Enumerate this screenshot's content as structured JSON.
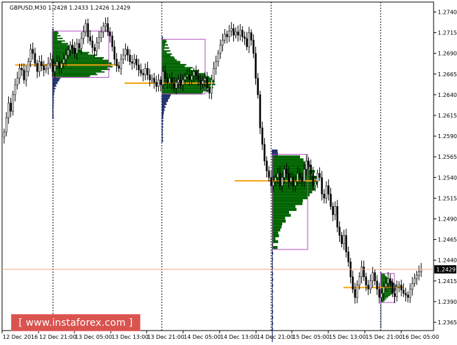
{
  "chart_data": {
    "type": "candlestick",
    "title": "GBPUSD,M30  1.2428 1.2433 1.2426 1.2429",
    "symbol": "GBPUSD",
    "timeframe": "M30",
    "ohlc_last": {
      "open": 1.2428,
      "high": 1.2433,
      "low": 1.2426,
      "close": 1.2429
    },
    "ylim": [
      1.2355,
      1.2752
    ],
    "y_ticks": [
      "1.2740",
      "1.2715",
      "1.2690",
      "1.2665",
      "1.2640",
      "1.2615",
      "1.2590",
      "1.2565",
      "1.2540",
      "1.2515",
      "1.2490",
      "1.2465",
      "1.2440",
      "1.2415",
      "1.2390",
      "1.2365"
    ],
    "x_ticks": [
      "12 Dec 2016",
      "12 Dec 21:00",
      "13 Dec 05:00",
      "13 Dec 13:00",
      "13 Dec 21:00",
      "14 Dec 05:00",
      "14 Dec 13:00",
      "14 Dec 21:00",
      "15 Dec 05:00",
      "15 Dec 13:00",
      "15 Dec 21:00",
      "16 Dec 05:00"
    ],
    "current_price": "1.2429",
    "current_price_line_color": "#f4a582",
    "candle_color": "#000000",
    "session_separators": [
      "12 Dec 21:00",
      "13 Dec 21:00",
      "14 Dec 21:00",
      "15 Dec 21:00"
    ],
    "closes": [
      1.2595,
      1.2612,
      1.263,
      1.262,
      1.264,
      1.2652,
      1.266,
      1.2672,
      1.267,
      1.2658,
      1.2668,
      1.268,
      1.2695,
      1.269,
      1.2678,
      1.2668,
      1.268,
      1.2675,
      1.267,
      1.2672,
      1.2678,
      1.2683,
      1.2668,
      1.2675,
      1.268,
      1.2672,
      1.2678,
      1.2683,
      1.2688,
      1.2694,
      1.27,
      1.2696,
      1.269,
      1.2702,
      1.2696,
      1.2708,
      1.2716,
      1.2726,
      1.271,
      1.2705,
      1.2697,
      1.2693,
      1.2703,
      1.2709,
      1.2716,
      1.2723,
      1.2726,
      1.2716,
      1.2711,
      1.2698,
      1.2683,
      1.2675,
      1.2672,
      1.2683,
      1.2688,
      1.2695,
      1.2688,
      1.268,
      1.2678,
      1.2683,
      1.2676,
      1.267,
      1.2666,
      1.2664,
      1.2672,
      1.2664,
      1.2658,
      1.266,
      1.2655,
      1.265,
      1.2658,
      1.2652,
      1.2668,
      1.266,
      1.2654,
      1.266,
      1.2654,
      1.2648,
      1.2655,
      1.2658,
      1.2652,
      1.2658,
      1.2662,
      1.2664,
      1.2658,
      1.2663,
      1.2668,
      1.2663,
      1.2658,
      1.2653,
      1.2657,
      1.266,
      1.2648,
      1.2642,
      1.2658,
      1.2672,
      1.268,
      1.269,
      1.27,
      1.2706,
      1.2713,
      1.271,
      1.2717,
      1.272,
      1.2712,
      1.2716,
      1.2712,
      1.2718,
      1.271,
      1.2708,
      1.2698,
      1.2715,
      1.2706,
      1.269,
      1.266,
      1.264,
      1.26,
      1.258,
      1.256,
      1.2548,
      1.254,
      1.253,
      1.2535,
      1.254,
      1.2545,
      1.253,
      1.254,
      1.255,
      1.2545,
      1.2535,
      1.254,
      1.253,
      1.2535,
      1.2545,
      1.254,
      1.2535,
      1.255,
      1.256,
      1.2555,
      1.2545,
      1.253,
      1.2535,
      1.2545,
      1.254,
      1.252,
      1.2515,
      1.253,
      1.252,
      1.2505,
      1.2495,
      1.2505,
      1.248,
      1.247,
      1.246,
      1.247,
      1.245,
      1.2438,
      1.242,
      1.2405,
      1.2395,
      1.241,
      1.242,
      1.2432,
      1.242,
      1.241,
      1.2405,
      1.2415,
      1.2425,
      1.2415,
      1.2405,
      1.2395,
      1.24,
      1.2408,
      1.2412,
      1.2418,
      1.2412,
      1.24,
      1.2396,
      1.2408,
      1.241,
      1.2404,
      1.24,
      1.2398,
      1.2395,
      1.2405,
      1.2412,
      1.2418,
      1.2422,
      1.2426,
      1.2429
    ],
    "profiles": [
      {
        "range": [
          1.2661,
          1.2717
        ],
        "vpoc": 1.2676,
        "color": "#006400"
      },
      {
        "range": [
          1.2641,
          1.2707
        ],
        "vpoc": 1.2654,
        "color": "#006400"
      },
      {
        "range": [
          1.2453,
          1.2568
        ],
        "vpoc": 1.2536,
        "color": "#006400"
      },
      {
        "range": [
          1.2389,
          1.2424
        ],
        "vpoc": 1.2407,
        "color": "#006400"
      }
    ]
  },
  "watermark": {
    "text": "[ www.instaforex.com ]",
    "color": "#d9534f"
  }
}
